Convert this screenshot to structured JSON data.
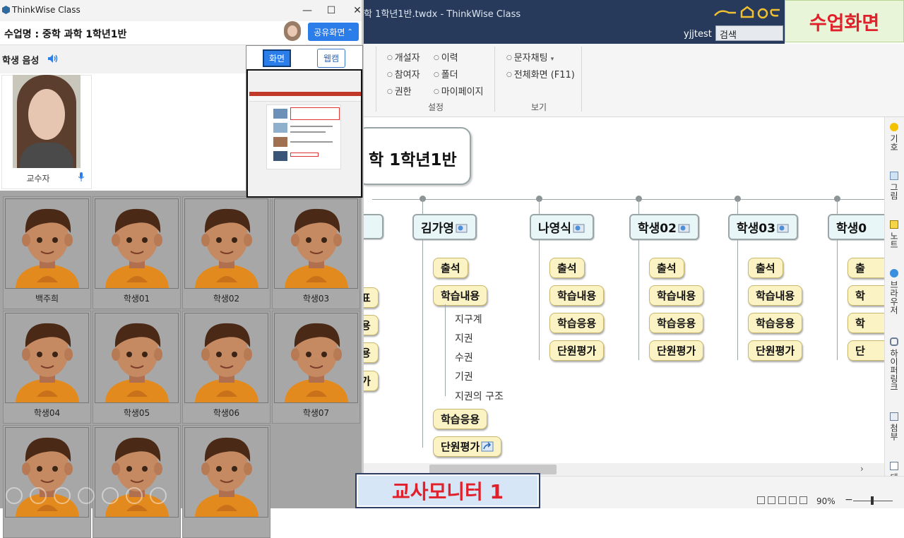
{
  "main_window": {
    "title": "학 1학년1반.twdx - ThinkWise Class",
    "mode_banner": "수업화면",
    "user": "yjjtest",
    "search_placeholder": "검색"
  },
  "ribbon": {
    "settings_items": [
      "개설자",
      "참여자",
      "권한",
      "이력",
      "폴더",
      "마이페이지"
    ],
    "settings_label": "설정",
    "view_items": [
      "문자채팅",
      "전체화면 (F11)"
    ],
    "view_label": "보기"
  },
  "mindmap": {
    "root": "학 1학년1반",
    "partial_leaves": [
      "표",
      "용",
      "용",
      "가"
    ],
    "students": [
      {
        "name": "김가영",
        "leaves": [
          "출석",
          "학습내용",
          "학습응용",
          "단원평가"
        ],
        "sub": [
          "지구계",
          "지권",
          "수권",
          "기권",
          "지권의 구조"
        ]
      },
      {
        "name": "나영식",
        "leaves": [
          "출석",
          "학습내용",
          "학습응용",
          "단원평가"
        ]
      },
      {
        "name": "학생02",
        "leaves": [
          "출석",
          "학습내용",
          "학습응용",
          "단원평가"
        ]
      },
      {
        "name": "학생03",
        "leaves": [
          "출석",
          "학습내용",
          "학습응용",
          "단원평가"
        ]
      },
      {
        "name": "학생0",
        "leaves": [
          "출",
          "학",
          "학",
          "단"
        ]
      }
    ]
  },
  "sidebar": [
    "기호",
    "그림",
    "노트",
    "브라우저",
    "하이퍼링크",
    "첨부",
    "태스"
  ],
  "status": {
    "zoom": "90%"
  },
  "class_window": {
    "title": "ThinkWise Class",
    "lesson": "수업명 : 중학 과학 1학년1반",
    "share_button": "공유화면",
    "audio_label": "학생 음성",
    "popup_tab_screen": "화면",
    "popup_tab_webcam": "웹캠",
    "teacher_name": "교수자",
    "students": [
      "백주희",
      "학생01",
      "학생02",
      "학생03",
      "학생04",
      "학생05",
      "학생06",
      "학생07",
      "",
      "",
      ""
    ]
  },
  "bottom_badge": "교사모니터 1"
}
